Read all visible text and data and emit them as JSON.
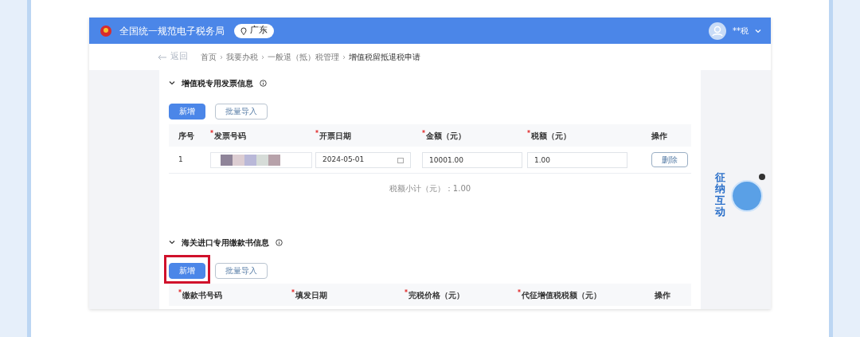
{
  "header": {
    "title": "全国统一规范电子税务局",
    "region": "广东",
    "user": "**税"
  },
  "breadcrumb": {
    "back": "返回",
    "items": [
      "首页",
      "我要办税",
      "一般退（抵）税管理",
      "增值税留抵退税申请"
    ]
  },
  "sections": [
    {
      "title": "增值税专用发票信息",
      "expanded": true,
      "buttons": [
        {
          "label": "新增",
          "kind": "primary",
          "highlighted": false
        },
        {
          "label": "批量导入",
          "kind": "outline",
          "highlighted": false
        }
      ],
      "columns": [
        {
          "label": "序号",
          "required": false
        },
        {
          "label": "发票号码",
          "required": true
        },
        {
          "label": "开票日期",
          "required": true
        },
        {
          "label": "金额（元）",
          "required": true
        },
        {
          "label": "税额（元）",
          "required": true
        },
        {
          "label": "操作",
          "required": false
        }
      ],
      "rows": [
        {
          "index": "1",
          "date": "2024-05-01",
          "amount": "10001.00",
          "tax": "1.00",
          "action": "删除"
        }
      ],
      "subtotal": "税额小计（元）：1.00"
    },
    {
      "title": "海关进口专用缴款书信息",
      "expanded": true,
      "buttons": [
        {
          "label": "新增",
          "kind": "primary",
          "highlighted": true
        },
        {
          "label": "批量导入",
          "kind": "outline",
          "highlighted": false
        }
      ],
      "columns": [
        {
          "label": "缴款书号码",
          "required": true
        },
        {
          "label": "填发日期",
          "required": true
        },
        {
          "label": "完税价格（元）",
          "required": true
        },
        {
          "label": "代征增值税税额（元）",
          "required": true
        },
        {
          "label": "操作",
          "required": false
        }
      ]
    }
  ],
  "assistant": {
    "label": "征纳互动"
  }
}
